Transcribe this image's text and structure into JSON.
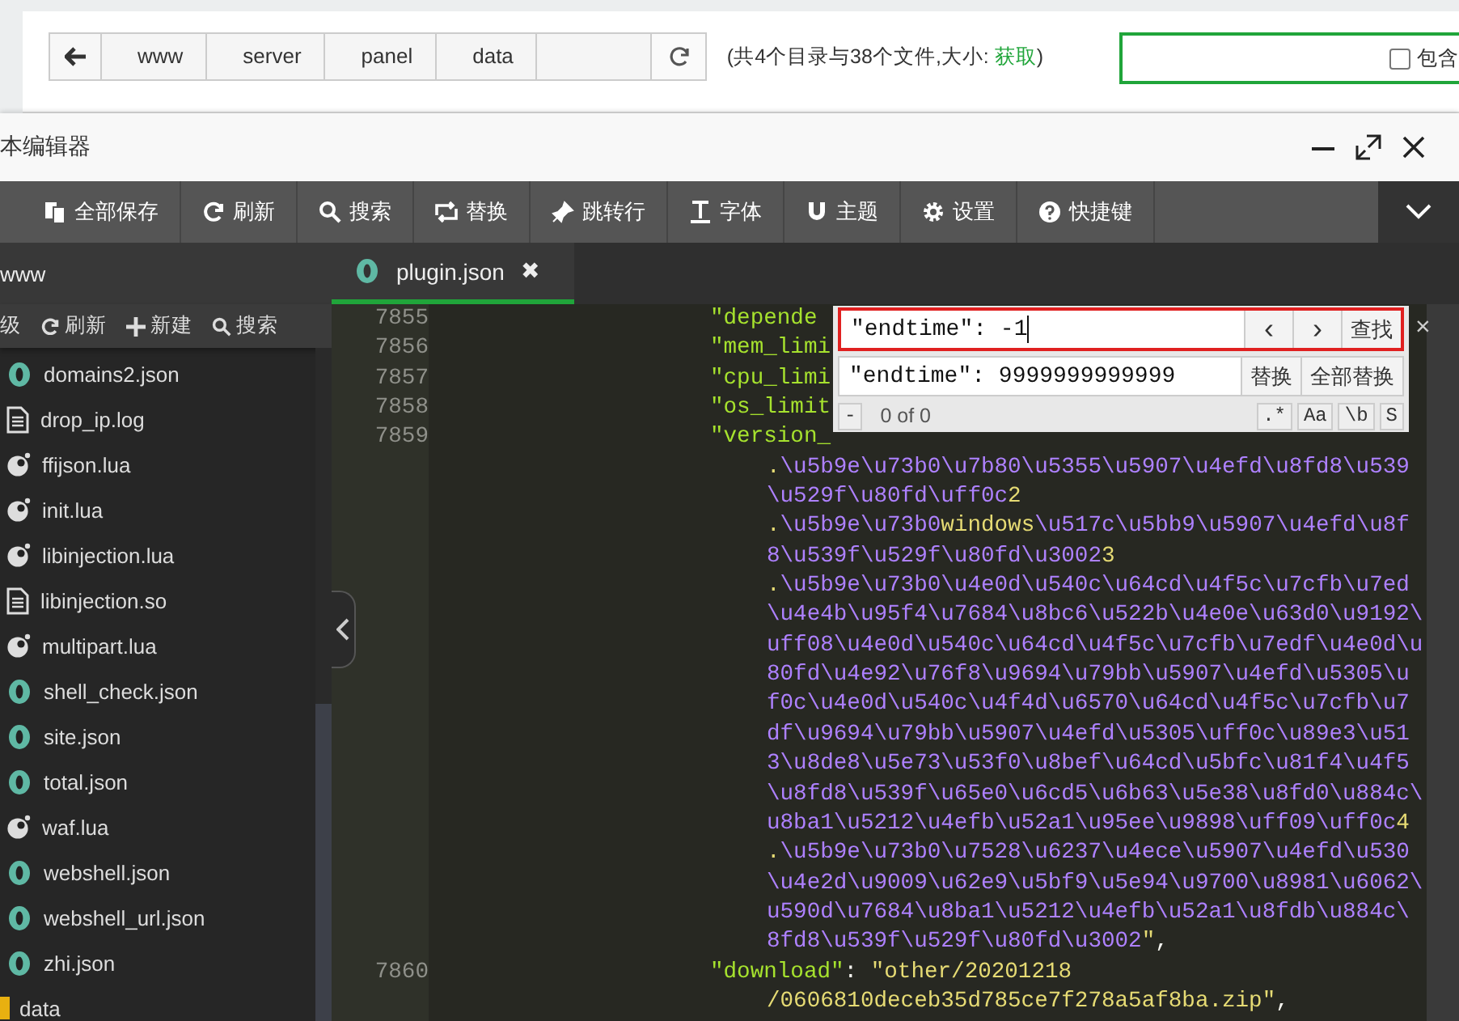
{
  "topbar": {
    "breadcrumb": [
      "www",
      "server",
      "panel",
      "data"
    ],
    "summary": "(共4个目录与38个文件,大小: ",
    "summary_link": "获取",
    "summary_end": ")",
    "include_box": {
      "label": "包含",
      "checked": false
    }
  },
  "editor": {
    "title": "本编辑器",
    "toolbar": [
      "全部保存",
      "刷新",
      "搜索",
      "替换",
      "跳转行",
      "字体",
      "主题",
      "设置",
      "快捷键"
    ],
    "sidebar": {
      "title": "www",
      "actions": [
        "级",
        "刷新",
        "新建",
        "搜索"
      ],
      "files": [
        {
          "name": "domains2.json",
          "kind": "json"
        },
        {
          "name": "drop_ip.log",
          "kind": "doc"
        },
        {
          "name": "ffijson.lua",
          "kind": "lua"
        },
        {
          "name": "init.lua",
          "kind": "lua"
        },
        {
          "name": "libinjection.lua",
          "kind": "lua"
        },
        {
          "name": "libinjection.so",
          "kind": "doc"
        },
        {
          "name": "multipart.lua",
          "kind": "lua"
        },
        {
          "name": "shell_check.json",
          "kind": "json"
        },
        {
          "name": "site.json",
          "kind": "json"
        },
        {
          "name": "total.json",
          "kind": "json"
        },
        {
          "name": "waf.lua",
          "kind": "lua"
        },
        {
          "name": "webshell.json",
          "kind": "json"
        },
        {
          "name": "webshell_url.json",
          "kind": "json"
        },
        {
          "name": "zhi.json",
          "kind": "json"
        },
        {
          "name": "data",
          "kind": "folder"
        }
      ]
    },
    "tabs": [
      {
        "label": "plugin.json",
        "close": "✖",
        "selected": true
      }
    ],
    "lines": [
      {
        "num": "7855",
        "segs": [
          {
            "t": "\"depende",
            "kind": "key"
          }
        ]
      },
      {
        "num": "7856",
        "segs": [
          {
            "t": "\"mem_limi",
            "kind": "key"
          }
        ]
      },
      {
        "num": "7857",
        "segs": [
          {
            "t": "\"cpu_limi",
            "kind": "key"
          }
        ]
      },
      {
        "num": "7858",
        "segs": [
          {
            "t": "\"os_limit",
            "kind": "key"
          }
        ]
      },
      {
        "num": "7859",
        "segs": [
          {
            "t": "\"version_",
            "kind": "key"
          }
        ]
      },
      {
        "segs": [
          {
            "t": ".",
            "kind": "str"
          },
          {
            "t": "\\u5b9e\\u73b0\\u7b80\\u5355\\u5907\\u4efd\\u8fd8\\u539",
            "kind": "esc"
          }
        ]
      },
      {
        "segs": [
          {
            "t": "\\u529f\\u80fd\\uff0c",
            "kind": "esc"
          },
          {
            "t": "2",
            "kind": "str"
          }
        ]
      },
      {
        "segs": [
          {
            "t": ".",
            "kind": "str"
          },
          {
            "t": "\\u5b9e\\u73b0",
            "kind": "esc"
          },
          {
            "t": "windows",
            "kind": "str"
          },
          {
            "t": "\\u517c\\u5bb9\\u5907\\u4efd\\u8f",
            "kind": "esc"
          }
        ]
      },
      {
        "segs": [
          {
            "t": "8\\u539f\\u529f\\u80fd\\u3002",
            "kind": "esc"
          },
          {
            "t": "3",
            "kind": "str"
          }
        ]
      },
      {
        "segs": [
          {
            "t": ".",
            "kind": "str"
          },
          {
            "t": "\\u5b9e\\u73b0\\u4e0d\\u540c\\u64cd\\u4f5c\\u7cfb\\u7ed",
            "kind": "esc"
          }
        ]
      },
      {
        "segs": [
          {
            "t": "\\u4e4b\\u95f4\\u7684\\u8bc6\\u522b\\u4e0e\\u63d0\\u9192\\",
            "kind": "esc"
          }
        ]
      },
      {
        "segs": [
          {
            "t": "uff08\\u4e0d\\u540c\\u64cd\\u4f5c\\u7cfb\\u7edf\\u4e0d\\u",
            "kind": "esc"
          }
        ]
      },
      {
        "segs": [
          {
            "t": "80fd\\u4e92\\u76f8\\u9694\\u79bb\\u5907\\u4efd\\u5305\\u",
            "kind": "esc"
          }
        ]
      },
      {
        "segs": [
          {
            "t": "f0c\\u4e0d\\u540c\\u4f4d\\u6570\\u64cd\\u4f5c\\u7cfb\\u7",
            "kind": "esc"
          }
        ]
      },
      {
        "segs": [
          {
            "t": "df\\u9694\\u79bb\\u5907\\u4efd\\u5305\\uff0c\\u89e3\\u51",
            "kind": "esc"
          }
        ]
      },
      {
        "segs": [
          {
            "t": "3\\u8de8\\u5e73\\u53f0\\u8bef\\u64cd\\u5bfc\\u81f4\\u4f5",
            "kind": "esc"
          }
        ]
      },
      {
        "segs": [
          {
            "t": "\\u8fd8\\u539f\\u65e0\\u6cd5\\u6b63\\u5e38\\u8fd0\\u884c\\",
            "kind": "esc"
          }
        ]
      },
      {
        "segs": [
          {
            "t": "u8ba1\\u5212\\u4efb\\u52a1\\u95ee\\u9898\\uff09\\uff0c",
            "kind": "esc"
          },
          {
            "t": "4",
            "kind": "str"
          }
        ]
      },
      {
        "segs": [
          {
            "t": ".",
            "kind": "str"
          },
          {
            "t": "\\u5b9e\\u73b0\\u7528\\u6237\\u4ece\\u5907\\u4efd\\u530",
            "kind": "esc"
          }
        ]
      },
      {
        "segs": [
          {
            "t": "\\u4e2d\\u9009\\u62e9\\u5bf9\\u5e94\\u9700\\u8981\\u6062\\",
            "kind": "esc"
          }
        ]
      },
      {
        "segs": [
          {
            "t": "u590d\\u7684\\u8ba1\\u5212\\u4efb\\u52a1\\u8fdb\\u884c\\",
            "kind": "esc"
          }
        ]
      },
      {
        "segs": [
          {
            "t": "8fd8\\u539f\\u529f\\u80fd\\u3002",
            "kind": "esc"
          },
          {
            "t": "\"",
            "kind": "str"
          },
          {
            "t": ",",
            "kind": "punct"
          }
        ]
      },
      {
        "num": "7860",
        "segs": [
          {
            "t": "\"download\"",
            "kind": "key"
          },
          {
            "t": ": ",
            "kind": "punct"
          },
          {
            "t": "\"other/20201218",
            "kind": "str"
          }
        ]
      },
      {
        "segs": [
          {
            "t": "/0606810deceb35d785ce7f278a5af8ba.zip\"",
            "kind": "str"
          },
          {
            "t": ",",
            "kind": "punct"
          }
        ]
      }
    ],
    "find": {
      "find_value": "\"endtime\": -1",
      "prev": "‹",
      "next": "›",
      "find_button": "查找",
      "replace_value": "\"endtime\": 9999999999999",
      "replace_button": "替换",
      "replace_all_button": "全部替换",
      "collapse": "-",
      "count": "0 of 0",
      "options": [
        ".*",
        "Aa",
        "\\b",
        "S"
      ],
      "close": "×"
    }
  }
}
